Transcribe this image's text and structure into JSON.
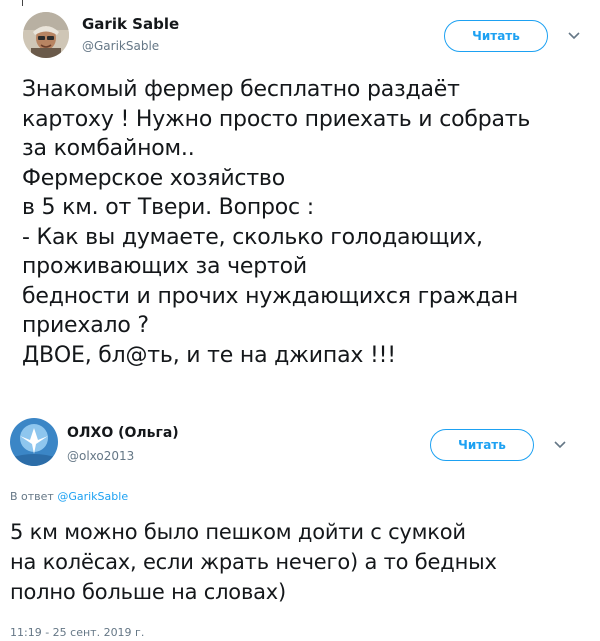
{
  "tweet1": {
    "name": "Garik Sable",
    "handle": "@GarikSable",
    "follow_label": "Читать",
    "lines": [
      "Знакомый фермер бесплатно раздаёт",
      "картоху ! Нужно просто приехать и собрать",
      "за комбайном..",
      "Фермерское хозяйство",
      "в 5 км. от Твери. Вопрос :",
      "- Как вы думаете, сколько голодающих,",
      "проживающих за чертой",
      "бедности и прочих нуждающихся граждан",
      "приехало ?",
      "ДВОЕ, бл@ть, и те на джипах !!!"
    ]
  },
  "tweet2": {
    "name": "ОЛХО (Ольга)",
    "handle": "@olxo2013",
    "follow_label": "Читать",
    "reply_prefix": "В ответ",
    "reply_mention": "@GarikSable",
    "lines": [
      "5 км можно было пешком дойти с сумкой",
      "на колёсах, если жрать нечего) а то бедных",
      "полно больше на словах)"
    ],
    "timestamp": "11:19 - 25 сент. 2019 г."
  },
  "colors": {
    "accent": "#1da1f2",
    "secondary_text": "#657786",
    "text": "#14171a"
  },
  "icons": [
    "avatar",
    "chevron-down-icon"
  ]
}
